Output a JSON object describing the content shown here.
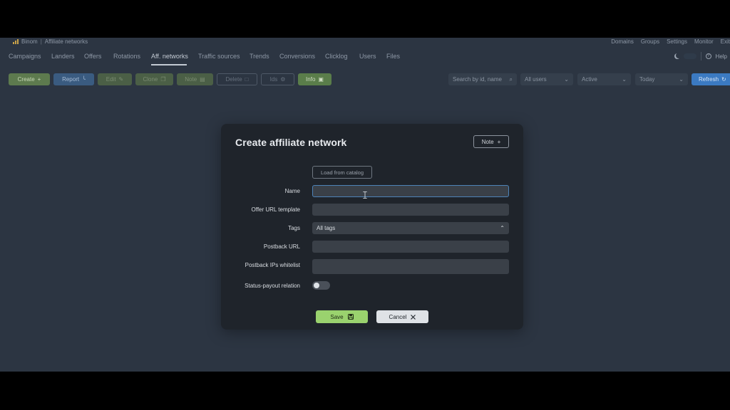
{
  "topbar": {
    "brand": "Binom",
    "section": "Affiliate networks",
    "links": [
      "Domains",
      "Groups",
      "Settings",
      "Monitor",
      "Exit"
    ]
  },
  "nav": {
    "tabs": [
      "Campaigns",
      "Landers",
      "Offers",
      "Rotations",
      "Aff. networks",
      "Traffic sources",
      "Trends",
      "Conversions",
      "Clicklog",
      "Users",
      "Files"
    ],
    "active": "Aff. networks",
    "help": "Help"
  },
  "toolbar": {
    "create": "Create",
    "report": "Report",
    "edit": "Edit",
    "clone": "Clone",
    "note": "Note",
    "delete": "Delete",
    "ids": "Ids",
    "info": "Info",
    "search_placeholder": "Search by id, name",
    "users": "All users",
    "status": "Active",
    "date": "Today",
    "refresh": "Refresh"
  },
  "modal": {
    "title": "Create affiliate network",
    "note_button": "Note",
    "load_from_catalog": "Load from catalog",
    "labels": {
      "name": "Name",
      "offer_url": "Offer URL template",
      "tags": "Tags",
      "postback_url": "Postback URL",
      "postback_ips": "Postback IPs whitelist",
      "status_payout": "Status-payout relation"
    },
    "tags_value": "All tags",
    "name_value": "",
    "offer_url_value": "",
    "postback_url_value": "",
    "postback_ips_value": "",
    "status_payout_enabled": false,
    "save": "Save",
    "cancel": "Cancel"
  },
  "colors": {
    "background": "#2c3542",
    "modal": "#1f242b",
    "save": "#9ad26e",
    "focus": "#4d83b8"
  }
}
